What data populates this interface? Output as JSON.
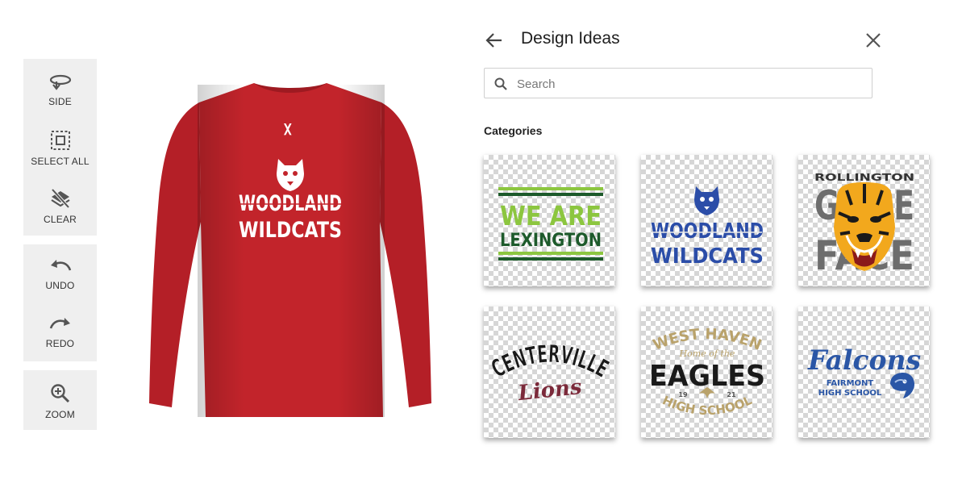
{
  "toolbar": {
    "side": "SIDE",
    "select_all": "SELECT ALL",
    "clear": "CLEAR",
    "undo": "UNDO",
    "redo": "REDO",
    "zoom": "ZOOM"
  },
  "shirt": {
    "color": "#c2242b",
    "print_line1": "WOODLAND",
    "print_line2": "WILDCATS"
  },
  "panel": {
    "title": "Design Ideas",
    "search_placeholder": "Search",
    "categories_heading": "Categories"
  },
  "designs": {
    "lexington": {
      "line1": "WE ARE",
      "line2": "LEXINGTON"
    },
    "woodland": {
      "line1": "WOODLAND",
      "line2": "WILDCATS"
    },
    "rollington": {
      "top": "ROLLINGTON",
      "word1": "GAME",
      "word2": "FACE"
    },
    "centerville": {
      "line1": "CENTERVILLE",
      "line2": "Lions"
    },
    "westhaven": {
      "top": "WEST HAVEN",
      "script": "Home of the",
      "main": "EAGLES",
      "left_num": "19",
      "right_num": "21",
      "bottom": "HIGH SCHOOL"
    },
    "falcons": {
      "line1": "Falcons",
      "line2": "FAIRMONT",
      "line3": "HIGH SCHOOL"
    }
  },
  "colors": {
    "toolbar_bg": "#efefef",
    "lexington_green": "#8cc63f",
    "lexington_dark": "#1d5a2b",
    "woodland_blue": "#2b4da8",
    "tiger_gray": "#6d6d6d",
    "lions_maroon": "#7b2a3a",
    "eagles_gold": "#b9a26b",
    "falcons_blue": "#2a56a6"
  }
}
